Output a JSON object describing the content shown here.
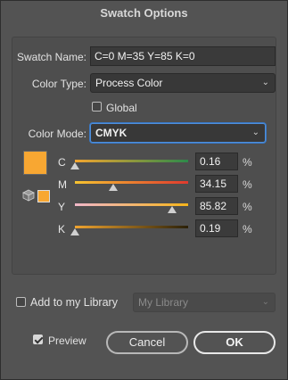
{
  "dialog": {
    "title": "Swatch Options"
  },
  "swatch_name": {
    "label": "Swatch Name:",
    "value": "C=0 M=35 Y=85 K=0"
  },
  "color_type": {
    "label": "Color Type:",
    "value": "Process Color"
  },
  "global": {
    "label": "Global",
    "checked": false
  },
  "color_mode": {
    "label": "Color Mode:",
    "value": "CMYK"
  },
  "swatch_color": "#f8a732",
  "channels": [
    {
      "name": "C",
      "value": "0.16",
      "level": 0.0016,
      "unit": "%"
    },
    {
      "name": "M",
      "value": "34.15",
      "level": 0.3415,
      "unit": "%"
    },
    {
      "name": "Y",
      "value": "85.82",
      "level": 0.8582,
      "unit": "%"
    },
    {
      "name": "K",
      "value": "0.19",
      "level": 0.0019,
      "unit": "%"
    }
  ],
  "library": {
    "label": "Add to my Library",
    "checked": false,
    "select_value": "My Library"
  },
  "preview": {
    "label": "Preview",
    "checked": true
  },
  "buttons": {
    "cancel": "Cancel",
    "ok": "OK"
  }
}
